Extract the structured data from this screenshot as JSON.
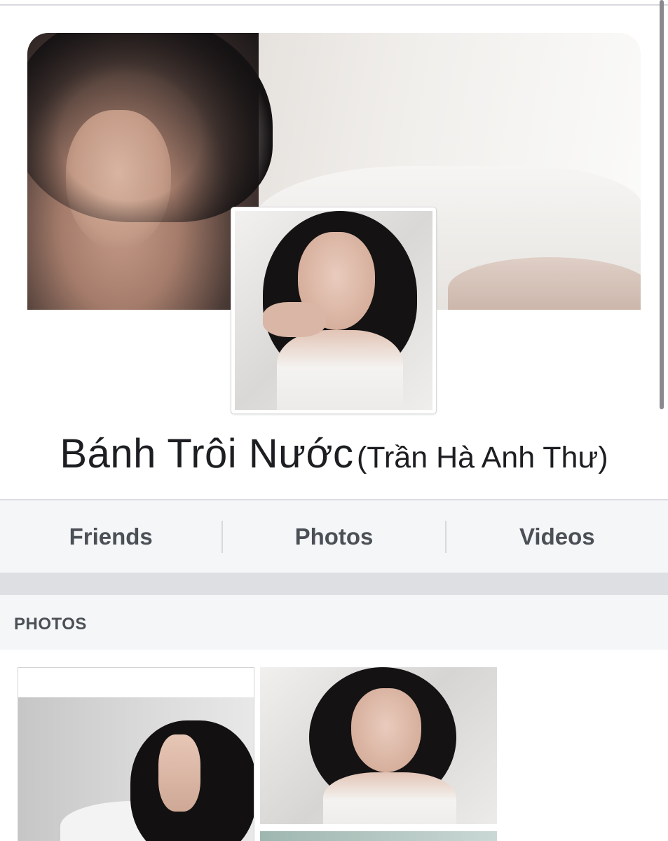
{
  "profile": {
    "name": "Bánh Trôi Nước",
    "alternate_name": "(Trần Hà Anh Thư)"
  },
  "tabs": [
    {
      "label": "Friends"
    },
    {
      "label": "Photos"
    },
    {
      "label": "Videos"
    }
  ],
  "photos_section": {
    "title": "PHOTOS"
  },
  "colors": {
    "tab_text": "#4b4f56",
    "name_text": "#1c1e21",
    "tab_background": "#f5f6f7",
    "separator_band": "#dddfe2"
  }
}
